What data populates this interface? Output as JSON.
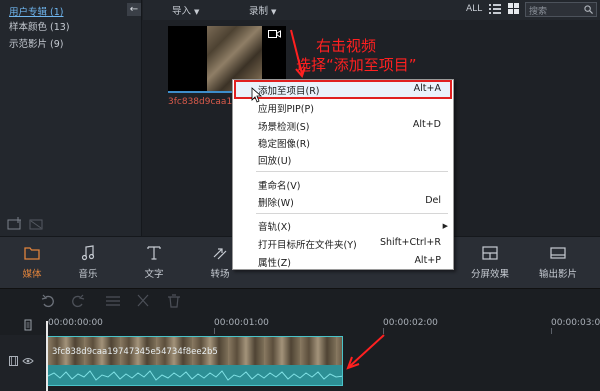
{
  "sidebar": {
    "items": [
      {
        "label": "用户专辑 (1)"
      },
      {
        "label": "样本颜色 (13)"
      },
      {
        "label": "示范影片 (9)"
      }
    ],
    "back_icon": "back-arrow-icon"
  },
  "media_toolbar": {
    "import_label": "导入",
    "record_label": "录制",
    "all_label": "ALL",
    "search_placeholder": "搜索"
  },
  "thumbnail": {
    "name": "3fc838d9caa1"
  },
  "context_menu": {
    "items": [
      {
        "label": "添加至项目(R)",
        "shortcut": "Alt+A"
      },
      {
        "label": "应用到PIP(P)",
        "shortcut": ""
      },
      {
        "label": "场景检测(S)",
        "shortcut": "Alt+D"
      },
      {
        "label": "稳定图像(R)",
        "shortcut": ""
      },
      {
        "label": "回放(U)",
        "shortcut": ""
      },
      {
        "label": "重命名(V)",
        "shortcut": ""
      },
      {
        "label": "删除(W)",
        "shortcut": "Del"
      },
      {
        "label": "音轨(X)",
        "shortcut": ""
      },
      {
        "label": "打开目标所在文件夹(Y)",
        "shortcut": "Shift+Ctrl+R"
      },
      {
        "label": "属性(Z)",
        "shortcut": "Alt+P"
      }
    ]
  },
  "toolbar": {
    "tools": [
      {
        "label": "媒体",
        "icon": "folder-icon"
      },
      {
        "label": "音乐",
        "icon": "music-note-icon"
      },
      {
        "label": "文字",
        "icon": "text-icon"
      },
      {
        "label": "转场",
        "icon": "transition-icon"
      },
      {
        "label": "分屏效果",
        "icon": "split-screen-icon"
      },
      {
        "label": "输出影片",
        "icon": "export-icon"
      }
    ]
  },
  "timeline": {
    "timecodes": [
      "00:00:00:00",
      "00:00:01:00",
      "00:00:02:00",
      "00:00:03:00"
    ],
    "clip_name": "3fc838d9caa19747345e54734f8ee2b5"
  },
  "annotation": {
    "line1": "右击视频",
    "line2": "选择“添加至项目”"
  },
  "colors": {
    "accent": "#e0833c",
    "highlight_border": "#e02020",
    "clip": "#2d8f95",
    "annotation": "#ff2020"
  }
}
